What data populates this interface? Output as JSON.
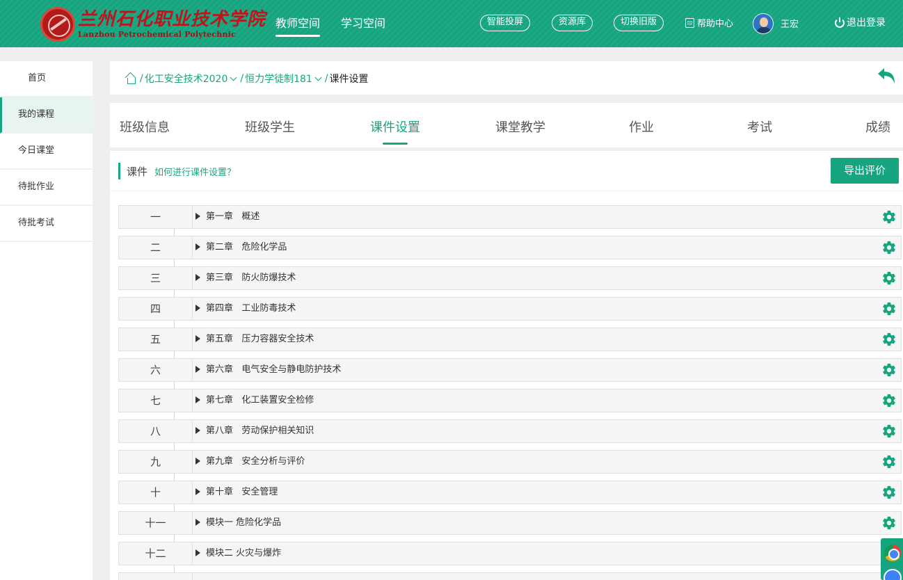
{
  "header": {
    "logo_cn": "兰州石化职业技术学院",
    "logo_en": "Lanzhou Petrochemical Polytechnic",
    "nav": [
      {
        "label": "教师空间",
        "active": true
      },
      {
        "label": "学习空间",
        "active": false
      }
    ],
    "pills": [
      "智能投屏",
      "资源库",
      "切换旧版"
    ],
    "help_label": "帮助中心",
    "username": "王宏",
    "logout_label": "退出登录"
  },
  "sidebar": {
    "items": [
      {
        "label": "首页",
        "active": false
      },
      {
        "label": "我的课程",
        "active": true
      },
      {
        "label": "今日课堂",
        "active": false
      },
      {
        "label": "待批作业",
        "active": false
      },
      {
        "label": "待批考试",
        "active": false
      }
    ]
  },
  "breadcrumb": {
    "course": "化工安全技术2020",
    "class": "恒力学徒制181",
    "current": "课件设置",
    "separator": "/"
  },
  "tabs": [
    {
      "label": "班级信息",
      "active": false
    },
    {
      "label": "班级学生",
      "active": false
    },
    {
      "label": "课件设置",
      "active": true
    },
    {
      "label": "课堂教学",
      "active": false
    },
    {
      "label": "作业",
      "active": false
    },
    {
      "label": "考试",
      "active": false
    },
    {
      "label": "成绩",
      "active": false
    }
  ],
  "toolbar": {
    "title": "课件",
    "help_link": "如何进行课件设置？",
    "export_label": "导出评价"
  },
  "chapters": [
    {
      "num": "一",
      "title": "第一章   概述"
    },
    {
      "num": "二",
      "title": "第二章   危险化学品"
    },
    {
      "num": "三",
      "title": "第三章   防火防爆技术"
    },
    {
      "num": "四",
      "title": "第四章   工业防毒技术"
    },
    {
      "num": "五",
      "title": "第五章   压力容器安全技术"
    },
    {
      "num": "六",
      "title": "第六章   电气安全与静电防护技术"
    },
    {
      "num": "七",
      "title": "第七章   化工装置安全检修"
    },
    {
      "num": "八",
      "title": "第八章   劳动保护相关知识"
    },
    {
      "num": "九",
      "title": "第九章   安全分析与评价"
    },
    {
      "num": "十",
      "title": "第十章   安全管理"
    },
    {
      "num": "十一",
      "title": "模块一 危险化学品"
    },
    {
      "num": "十二",
      "title": "模块二 火灾与爆炸"
    },
    {
      "num": "",
      "title": ""
    }
  ],
  "colors": {
    "brand": "#16a57f",
    "logo_red": "#c0141c"
  }
}
